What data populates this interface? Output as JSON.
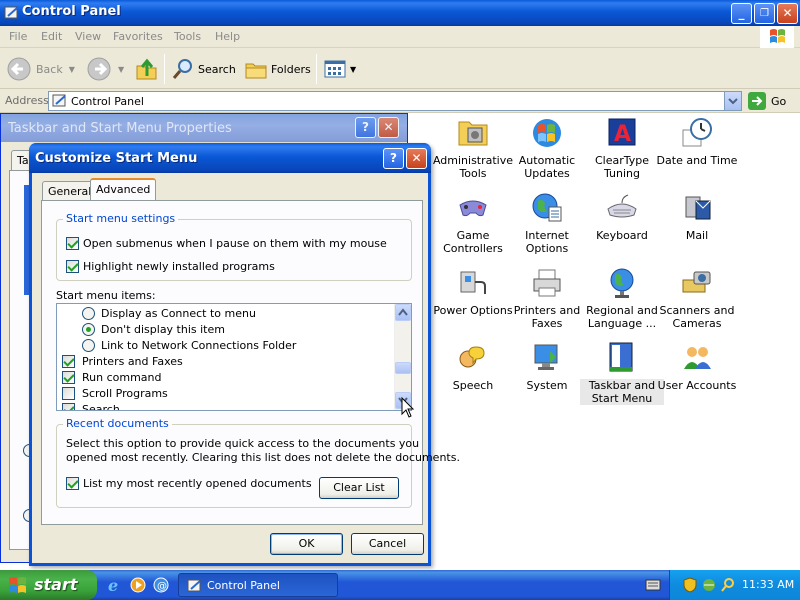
{
  "window": {
    "title": "Control Panel",
    "caption_buttons": {
      "minimize": "_",
      "maximize": "❐",
      "close": "✕"
    }
  },
  "menu": [
    "File",
    "Edit",
    "View",
    "Favorites",
    "Tools",
    "Help"
  ],
  "toolbar": {
    "back_label": "Back",
    "search_label": "Search",
    "folders_label": "Folders"
  },
  "address": {
    "label": "Address",
    "value": "Control Panel",
    "go_label": "Go"
  },
  "icons": [
    {
      "name": "Administrative Tools",
      "line1": "Administrative",
      "line2": "Tools",
      "icon": "admin-tools-icon"
    },
    {
      "name": "Automatic Updates",
      "line1": "Automatic",
      "line2": "Updates",
      "icon": "automatic-updates-icon"
    },
    {
      "name": "ClearType Tuning",
      "line1": "ClearType",
      "line2": "Tuning",
      "icon": "cleartype-icon"
    },
    {
      "name": "Date and Time",
      "line1": "Date and Time",
      "line2": "",
      "icon": "clock-icon"
    },
    {
      "name": "Game Controllers",
      "line1": "Game",
      "line2": "Controllers",
      "icon": "gamepad-icon"
    },
    {
      "name": "Internet Options",
      "line1": "Internet",
      "line2": "Options",
      "icon": "globe-icon"
    },
    {
      "name": "Keyboard",
      "line1": "Keyboard",
      "line2": "",
      "icon": "keyboard-icon"
    },
    {
      "name": "Mail",
      "line1": "Mail",
      "line2": "",
      "icon": "mail-icon"
    },
    {
      "name": "Power Options",
      "line1": "Power Options",
      "line2": "",
      "icon": "power-icon"
    },
    {
      "name": "Printers and Faxes",
      "line1": "Printers and",
      "line2": "Faxes",
      "icon": "printer-icon"
    },
    {
      "name": "Regional and Language",
      "line1": "Regional and",
      "line2": "Language ...",
      "icon": "regional-globe-icon"
    },
    {
      "name": "Scanners and Cameras",
      "line1": "Scanners and",
      "line2": "Cameras",
      "icon": "camera-icon"
    },
    {
      "name": "Speech",
      "line1": "Speech",
      "line2": "",
      "icon": "speech-icon"
    },
    {
      "name": "System",
      "line1": "System",
      "line2": "",
      "icon": "system-monitor-icon"
    },
    {
      "name": "Taskbar and Start Menu",
      "line1": "Taskbar and",
      "line2": "Start Menu",
      "icon": "taskbar-icon",
      "selected": true
    },
    {
      "name": "User Accounts",
      "line1": "User Accounts",
      "line2": "",
      "icon": "users-icon"
    }
  ],
  "taskbar_props": {
    "title": "Taskbar and Start Menu Properties",
    "tab_fragment": "Ta",
    "help_btn": "?",
    "close_btn": "✕"
  },
  "customize": {
    "title": "Customize Start Menu",
    "help_btn": "?",
    "close_btn": "✕",
    "tabs": [
      "General",
      "Advanced"
    ],
    "active_tab": "Advanced",
    "settings_group": {
      "legend": "Start menu settings",
      "options": [
        {
          "label": "Open submenus when I pause on them with my mouse",
          "checked": true
        },
        {
          "label": "Highlight newly installed programs",
          "checked": true
        }
      ]
    },
    "items_label": "Start menu items:",
    "items": [
      {
        "kind": "radio",
        "label": "Display as Connect to menu",
        "checked": false
      },
      {
        "kind": "radio",
        "label": "Don't display this item",
        "checked": true
      },
      {
        "kind": "radio",
        "label": "Link to Network Connections Folder",
        "checked": false
      },
      {
        "kind": "check",
        "label": "Printers and Faxes",
        "checked": true
      },
      {
        "kind": "check",
        "label": "Run command",
        "checked": true
      },
      {
        "kind": "check",
        "label": "Scroll Programs",
        "checked": false
      },
      {
        "kind": "check",
        "label": "Search",
        "checked": true
      }
    ],
    "recent_group": {
      "legend": "Recent documents",
      "description": "Select this option to provide quick access to the documents you opened most recently.  Clearing this list does not delete the documents.",
      "desc_line1": "Select this option to provide quick access to the documents you",
      "desc_line2": "opened most recently.  Clearing this list does not delete the documents.",
      "option_label": "List my most recently opened documents",
      "option_checked": true,
      "clear_label": "Clear List"
    },
    "ok_label": "OK",
    "cancel_label": "Cancel"
  },
  "taskbar": {
    "start_label": "start",
    "task_label": "Control Panel",
    "clock": "11:33 AM"
  },
  "colors": {
    "title_blue": "#0a53d6",
    "start_green": "#3c9a3c",
    "dialog_face": "#ece9d8",
    "legend_blue": "#0046d5"
  }
}
